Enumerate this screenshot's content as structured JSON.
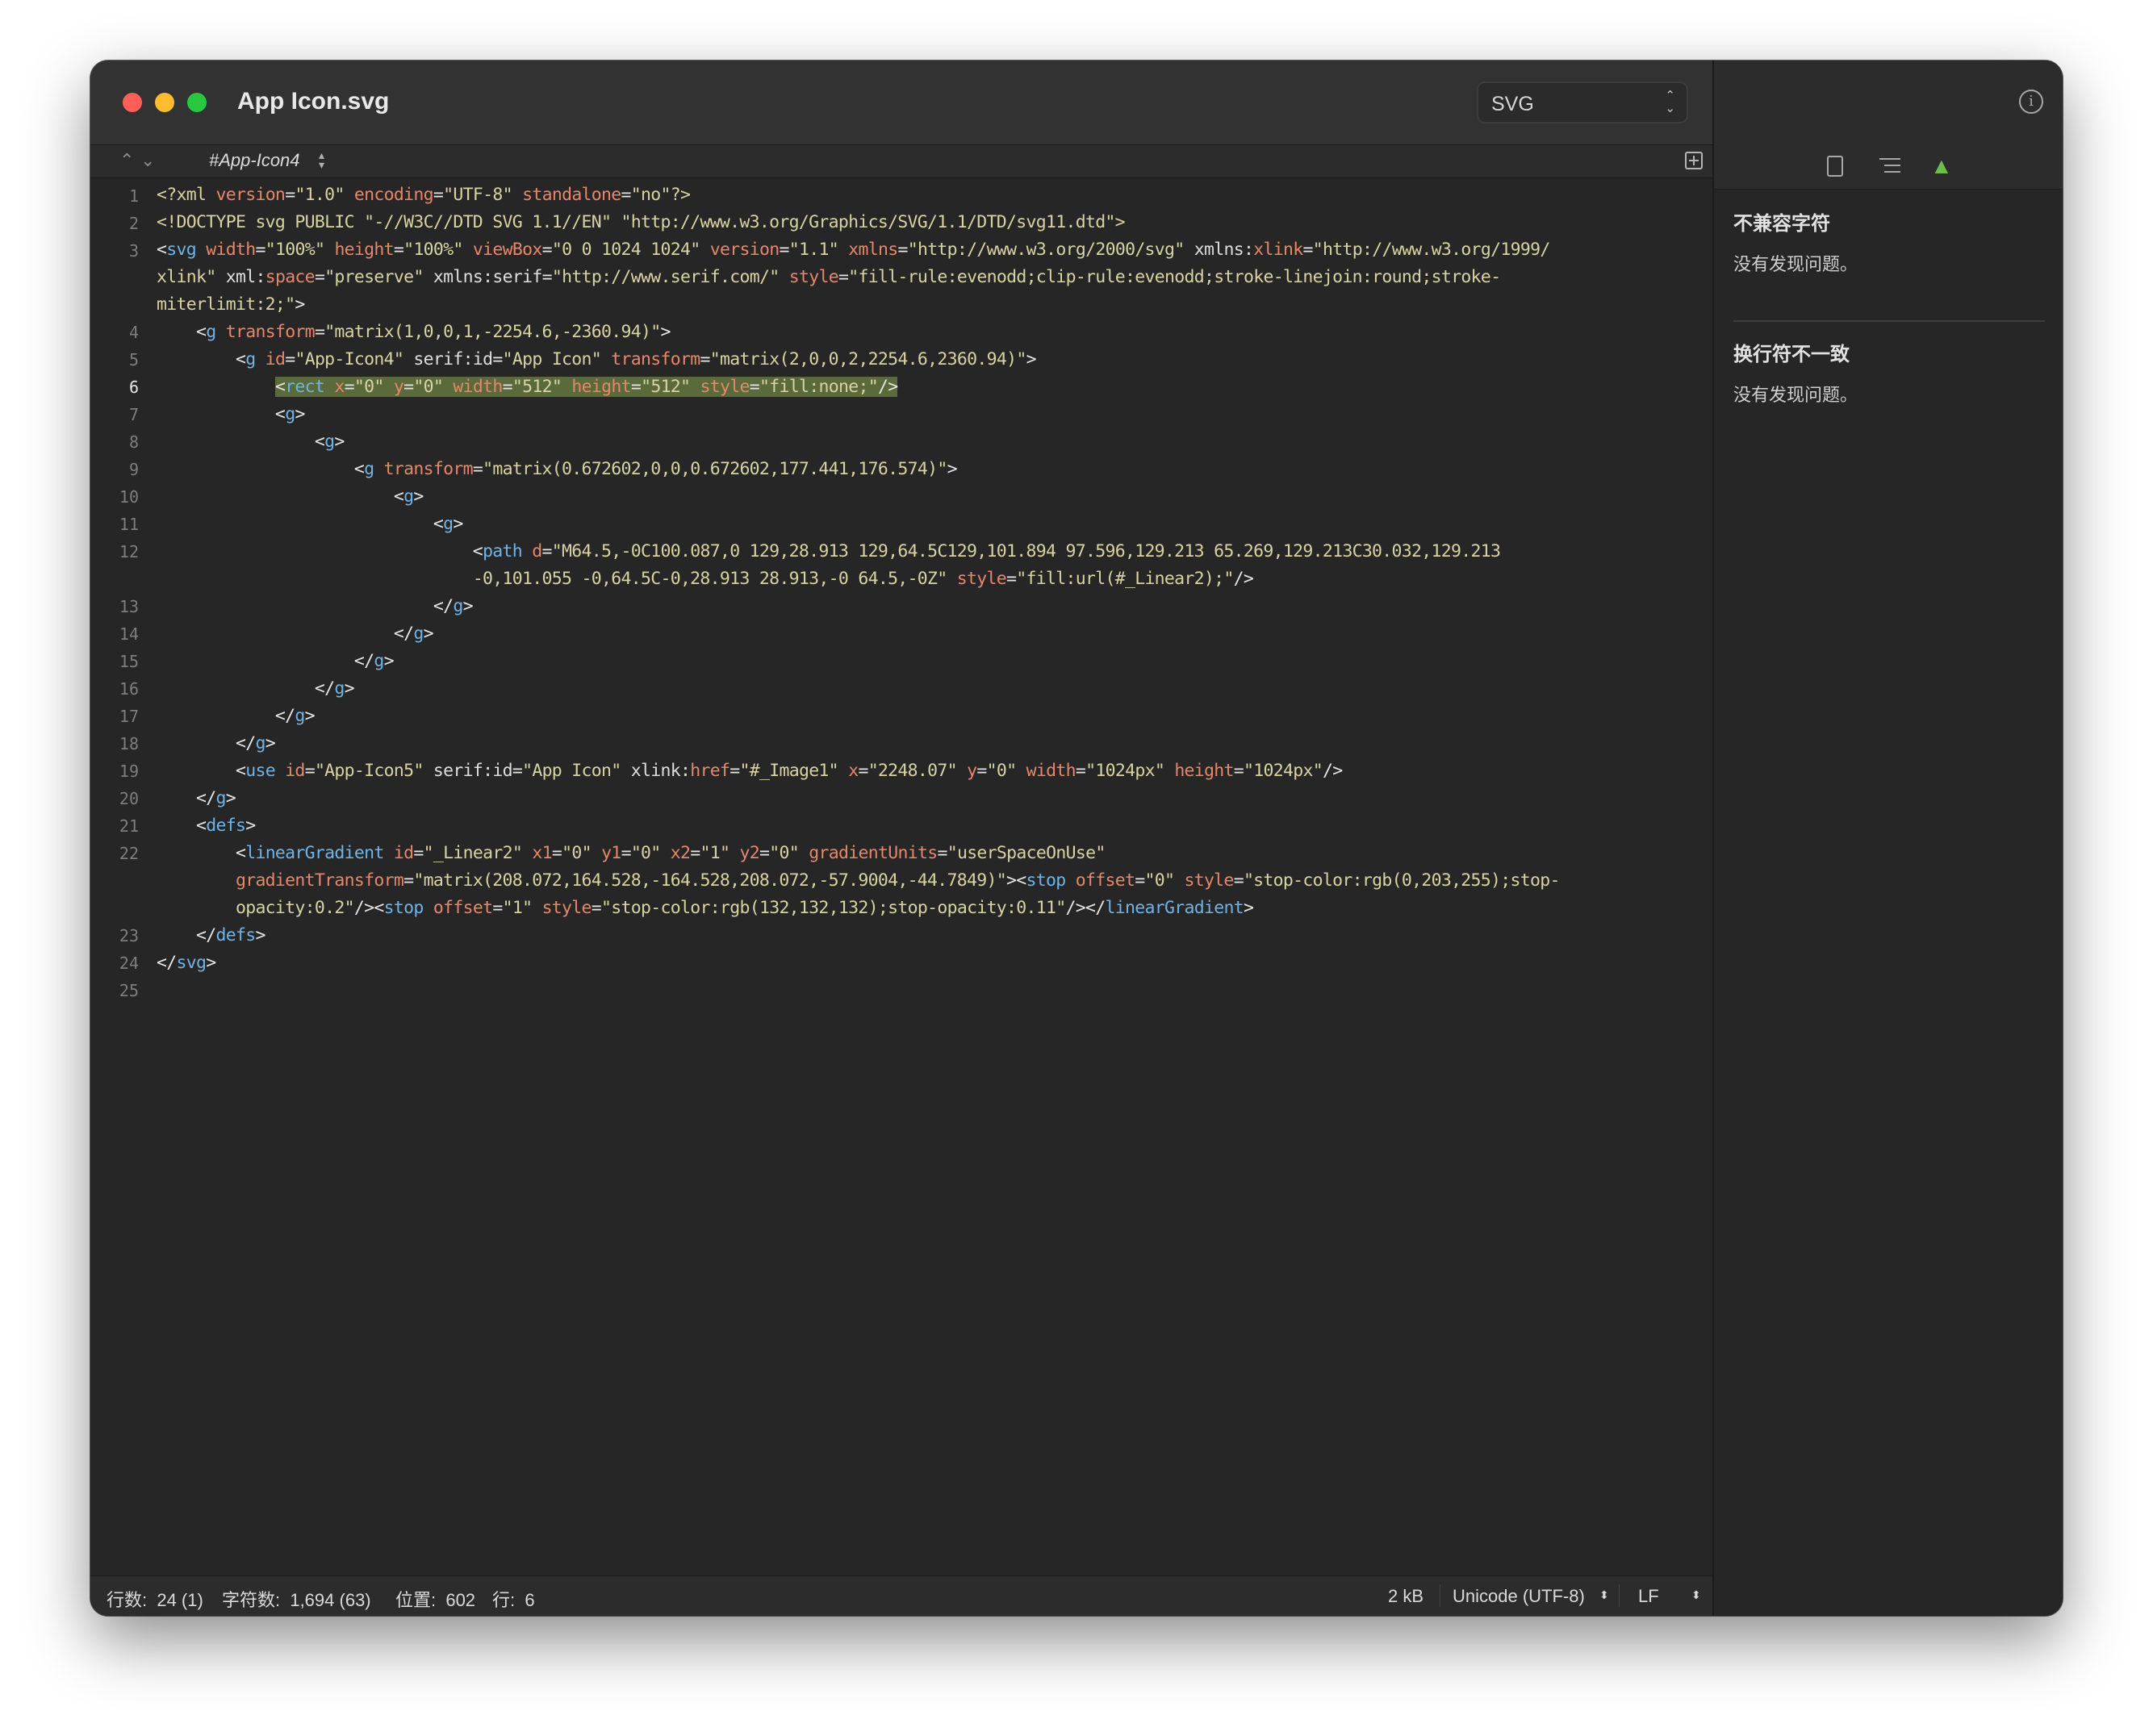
{
  "window": {
    "title": "App Icon.svg",
    "syntax_mode": "SVG"
  },
  "navbar": {
    "breadcrumb": "#App-Icon4",
    "prev_arrow": "⌃",
    "next_arrow": "⌄"
  },
  "editor": {
    "line_numbers": [
      "1",
      "2",
      "3",
      "",
      "",
      "4",
      "5",
      "6",
      "7",
      "8",
      "9",
      "10",
      "11",
      "12",
      "",
      "13",
      "14",
      "15",
      "16",
      "17",
      "18",
      "19",
      "20",
      "21",
      "22",
      "",
      "",
      "23",
      "24",
      "25"
    ],
    "active_line": "6"
  },
  "status": {
    "lines": "行数:  24 (1)",
    "chars": "字符数:  1,694 (63)",
    "position": "位置:  602",
    "row": "行:  6",
    "size": "2 kB",
    "encoding": "Unicode (UTF-8)",
    "line_ending": "LF"
  },
  "inspector": {
    "section1": {
      "title": "不兼容字符",
      "text": "没有发现问题。"
    },
    "section2": {
      "title": "换行符不一致",
      "text": "没有发现问题。"
    }
  },
  "colors": {
    "window_bg": "#262626",
    "highlight": "#5b6a3a",
    "element": "#6fb4e8",
    "attribute": "#e8866b",
    "value": "#d8d3a2",
    "warning": "#6cc04a"
  }
}
